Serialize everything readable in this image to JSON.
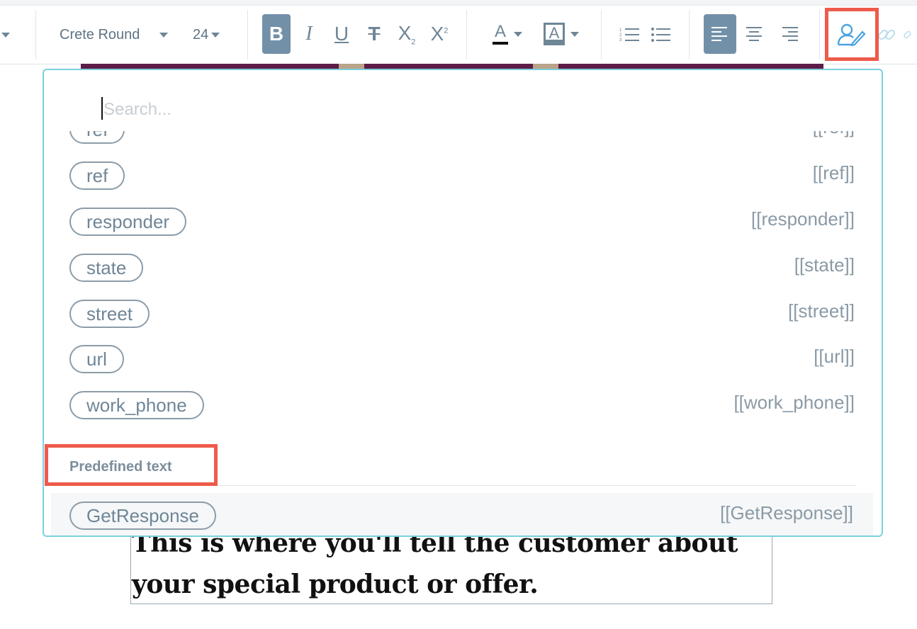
{
  "toolbar": {
    "font_family": "Crete Round",
    "font_size": "24",
    "bold_glyph": "B",
    "italic_glyph": "I",
    "underline_glyph": "U",
    "strike_glyph": "T",
    "subscript_glyph": "X",
    "subscript_mark": "2",
    "superscript_glyph": "X",
    "superscript_mark": "2",
    "text_color_glyph": "A",
    "highlight_glyph": "A",
    "colors": {
      "active_button": "#7290a8",
      "accent": "#4aa3df",
      "highlight_frame": "#ee5a4b"
    }
  },
  "dropdown": {
    "search_placeholder": "Search...",
    "items": [
      {
        "label": "ref",
        "token": "[[ref]]"
      },
      {
        "label": "ref",
        "token": "[[ref]]"
      },
      {
        "label": "responder",
        "token": "[[responder]]"
      },
      {
        "label": "state",
        "token": "[[state]]"
      },
      {
        "label": "street",
        "token": "[[street]]"
      },
      {
        "label": "url",
        "token": "[[url]]"
      },
      {
        "label": "work_phone",
        "token": "[[work_phone]]"
      }
    ],
    "section_title": "Predefined text",
    "predefined": [
      {
        "label": "GetResponse",
        "token": "[[GetResponse]]"
      }
    ]
  },
  "content": {
    "line1": "This is where you'll tell the customer about",
    "line2": "your special product or offer."
  }
}
